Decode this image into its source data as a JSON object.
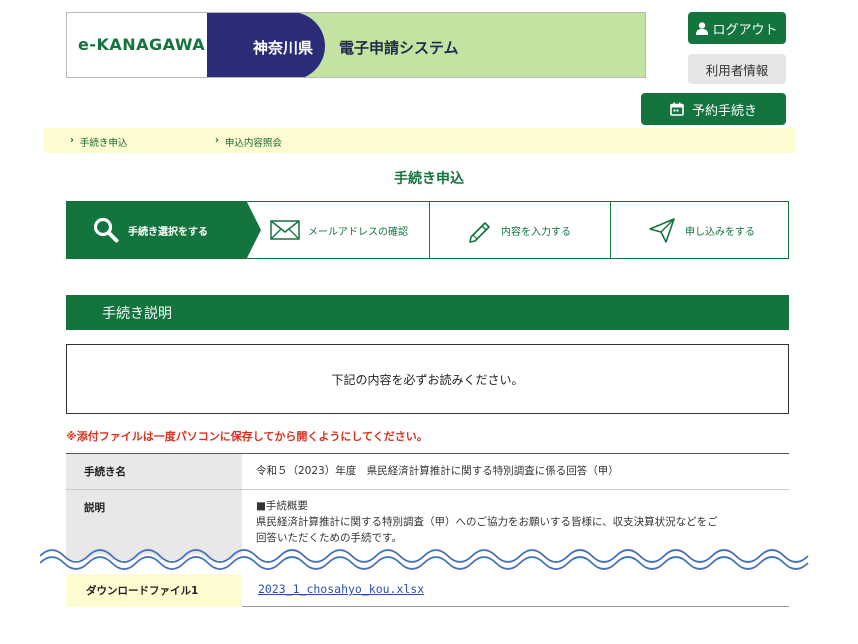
{
  "header": {
    "logo_text": "e-KANAGAWA",
    "prefecture": "神奈川県",
    "system_name": "電子申請システム",
    "logout_label": "ログアウト",
    "user_info_label": "利用者情報",
    "reservation_label": "予約手続き"
  },
  "breadcrumb": {
    "items": [
      {
        "label": "手続き申込"
      },
      {
        "label": "申込内容照会"
      }
    ]
  },
  "page_title": "手続き申込",
  "steps": [
    {
      "label": "手続き選択をする",
      "icon": "search-icon",
      "active": true
    },
    {
      "label": "メールアドレスの確認",
      "icon": "mail-icon",
      "active": false
    },
    {
      "label": "内容を入力する",
      "icon": "pencil-icon",
      "active": false
    },
    {
      "label": "申し込みをする",
      "icon": "send-icon",
      "active": false
    }
  ],
  "section": {
    "title": "手続き説明",
    "notice": "下記の内容を必ずお読みください。",
    "warning": "※添付ファイルは一度パソコンに保存してから開くようにしてください。"
  },
  "table": {
    "name_label": "手続き名",
    "name_value": "令和５（2023）年度　県民経済計算推計に関する特別調査に係る回答（甲）",
    "desc_label": "説明",
    "desc_line1": "■手続概要",
    "desc_line2": "県民経済計算推計に関する特別調査（甲）へのご協力をお願いする皆様に、収支決算状況などをご",
    "desc_line3": "回答いただくための手続です。",
    "download_label": "ダウンロードファイル1",
    "download_file": "2023_1_chosahyo_kou.xlsx"
  },
  "colors": {
    "primary_green": "#14743e",
    "banner_green": "#c4e3a3",
    "navy": "#2a2c78",
    "breadcrumb_bg": "#fdfbd0",
    "warning_red": "#d8331f",
    "link_blue": "#2a50a8"
  }
}
